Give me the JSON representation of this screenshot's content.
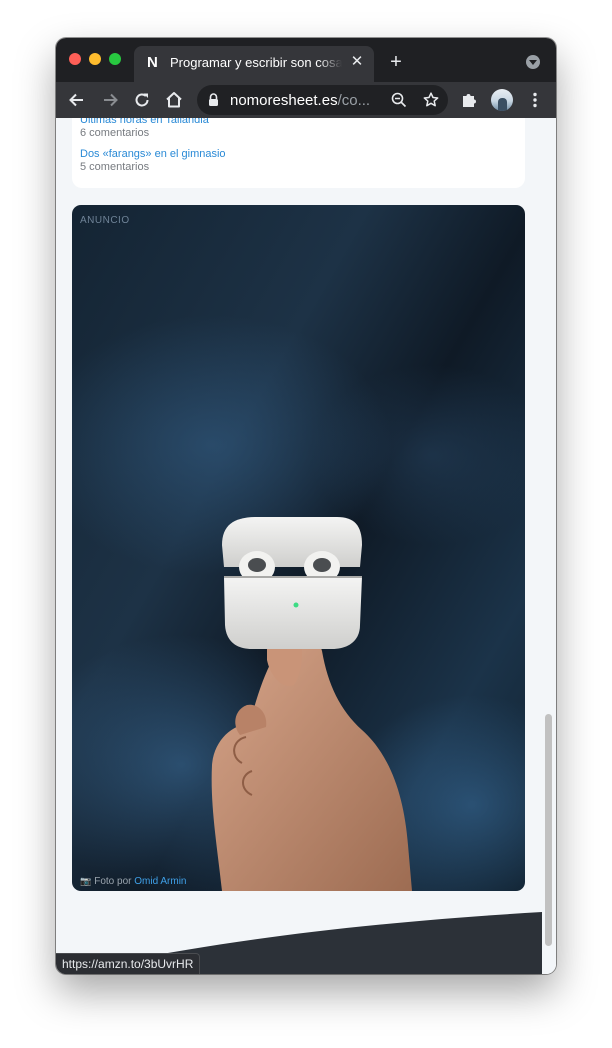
{
  "browser": {
    "tab": {
      "favicon_letter": "N",
      "title": "Programar y escribir son cosas parecidas"
    },
    "address": {
      "domain": "nomoresheet.es",
      "path": "/co..."
    },
    "status_url": "https://amzn.to/3bUvrHR"
  },
  "page": {
    "recent_posts": [
      {
        "title": "Últimas horas en Tailandia",
        "comments": "6 comentarios"
      },
      {
        "title": "Dos «farangs» en el gimnasio",
        "comments": "5 comentarios"
      }
    ],
    "ad": {
      "label": "ANUNCIO",
      "credit_prefix": "Foto por",
      "credit_author": "Omid Armin"
    }
  },
  "colors": {
    "link": "#2a8ad6",
    "footer": "#2c3138",
    "page_bg": "#f3f6f9"
  }
}
